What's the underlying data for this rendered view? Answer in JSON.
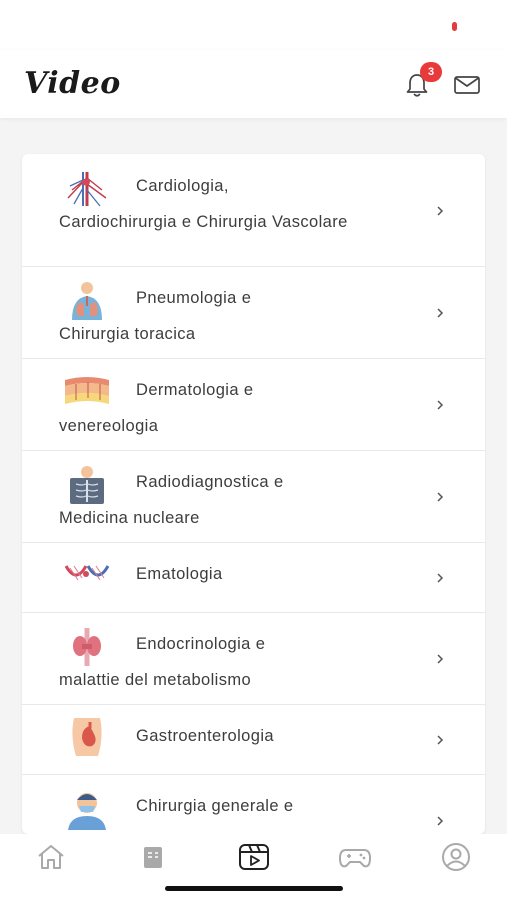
{
  "header": {
    "title": "Video",
    "notification_count": "3"
  },
  "colors": {
    "accent": "#e83a3a",
    "background": "#f4f4f4",
    "card": "#ffffff",
    "text": "#3d3d3d"
  },
  "specialties": [
    {
      "line1": "Cardiologia,",
      "rest": "Cardiochirurgia e Chirurgia Vascolare",
      "icon": "heart-vessels-icon"
    },
    {
      "line1": "Pneumologia e",
      "rest": "Chirurgia toracica",
      "icon": "lungs-icon"
    },
    {
      "line1": "Dermatologia e",
      "rest": "venereologia",
      "icon": "skin-layers-icon"
    },
    {
      "line1": "Radiodiagnostica e",
      "rest": "Medicina nucleare",
      "icon": "xray-chest-icon"
    },
    {
      "line1": "Ematologia",
      "rest": "",
      "icon": "blood-vessels-icon"
    },
    {
      "line1": "Endocrinologia e",
      "rest": "malattie del metabolismo",
      "icon": "thyroid-icon"
    },
    {
      "line1": "Gastroenterologia",
      "rest": "",
      "icon": "stomach-icon"
    },
    {
      "line1": "Chirurgia generale e",
      "rest": "",
      "icon": "surgeon-icon"
    }
  ],
  "tabbar": {
    "items": [
      "home-icon",
      "book-icon",
      "video-icon",
      "gamepad-icon",
      "profile-icon"
    ],
    "active": "video-icon"
  }
}
